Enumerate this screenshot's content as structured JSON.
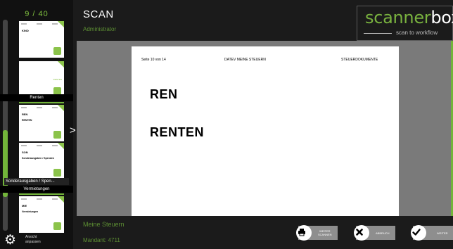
{
  "sidebar": {
    "page_counter": "9 / 40",
    "thumbnails": [
      {
        "title": "KIND",
        "subtitle": ""
      },
      {
        "title": "",
        "subtitle": "",
        "side_text": "RENTEN"
      },
      {
        "title": "REN",
        "subtitle": "RENTEN"
      },
      {
        "title": "SON",
        "subtitle": "Sonderausgaben / Spenden"
      },
      {
        "title": "MIE",
        "subtitle": "Vermietungen"
      }
    ],
    "labels": {
      "renten": "Renten",
      "sonderausgaben": "Sonderausgaben / Spen...",
      "vermietungen": "Vermietungen"
    },
    "settings": {
      "line1": "Ansicht",
      "line2": "anpassen"
    }
  },
  "header": {
    "title": "SCAN",
    "user": "Administrator"
  },
  "logo": {
    "part1": "scanner",
    "part2": "box",
    "tagline": "scan to workflow"
  },
  "document": {
    "header_left": "Seite 10 von 14",
    "header_center": "DATEV MEINE STEUERN",
    "header_right": "STEUERDOKUMENTE",
    "heading1": "REN",
    "heading2": "RENTEN"
  },
  "footer": {
    "workflow": "Meine Steuern",
    "client": "Mandant: 4711"
  },
  "buttons": {
    "continue_scan": {
      "line1": "WEITER",
      "line2": "SCANNEN"
    },
    "cancel": "ABBRUCH",
    "next": "WEITER"
  },
  "colors": {
    "accent": "#79b23f",
    "background": "#1b1b1b",
    "viewer": "#7a7a7a"
  }
}
